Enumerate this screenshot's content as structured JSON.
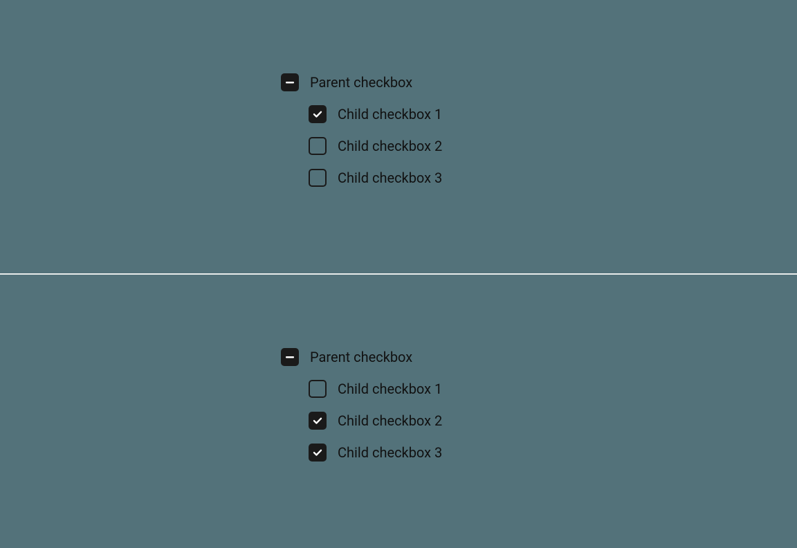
{
  "colors": {
    "background": "#53727a",
    "checkbox_fill": "#1a1a1a",
    "divider": "#e9eceb"
  },
  "groups": [
    {
      "parent": {
        "label": "Parent checkbox",
        "state": "indeterminate"
      },
      "children": [
        {
          "label": "Child checkbox 1",
          "state": "checked"
        },
        {
          "label": "Child checkbox 2",
          "state": "unchecked"
        },
        {
          "label": "Child checkbox 3",
          "state": "unchecked"
        }
      ]
    },
    {
      "parent": {
        "label": "Parent checkbox",
        "state": "indeterminate"
      },
      "children": [
        {
          "label": "Child checkbox 1",
          "state": "unchecked"
        },
        {
          "label": "Child checkbox 2",
          "state": "checked"
        },
        {
          "label": "Child checkbox 3",
          "state": "checked"
        }
      ]
    }
  ]
}
